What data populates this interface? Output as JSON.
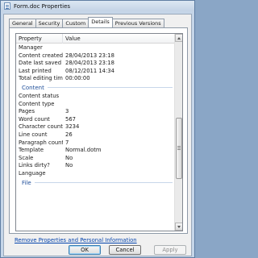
{
  "window": {
    "title": "Form.doc Properties"
  },
  "tabs": [
    {
      "label": "General",
      "active": false
    },
    {
      "label": "Security",
      "active": false
    },
    {
      "label": "Custom",
      "active": false
    },
    {
      "label": "Details",
      "active": true
    },
    {
      "label": "Previous Versions",
      "active": false
    }
  ],
  "columns": {
    "property": "Property",
    "value": "Value"
  },
  "rows_top": [
    {
      "k": "Manager",
      "v": ""
    },
    {
      "k": "Content created",
      "v": "28/04/2013 23:18"
    },
    {
      "k": "Date last saved",
      "v": "28/04/2013 23:18"
    },
    {
      "k": "Last printed",
      "v": "08/12/2011 14:34"
    },
    {
      "k": "Total editing time",
      "v": "00:00:00"
    }
  ],
  "group_content": "Content",
  "rows_content": [
    {
      "k": "Content status",
      "v": ""
    },
    {
      "k": "Content type",
      "v": ""
    },
    {
      "k": "Pages",
      "v": "3"
    },
    {
      "k": "Word count",
      "v": "567"
    },
    {
      "k": "Character count",
      "v": "3234"
    },
    {
      "k": "Line count",
      "v": "26"
    },
    {
      "k": "Paragraph count",
      "v": "7"
    },
    {
      "k": "Template",
      "v": "Normal.dotm"
    },
    {
      "k": "Scale",
      "v": "No"
    },
    {
      "k": "Links dirty?",
      "v": "No"
    },
    {
      "k": "Language",
      "v": ""
    }
  ],
  "group_file": "File",
  "remove_link": "Remove Properties and Personal Information",
  "buttons": {
    "ok": "OK",
    "cancel": "Cancel",
    "apply": "Apply"
  }
}
